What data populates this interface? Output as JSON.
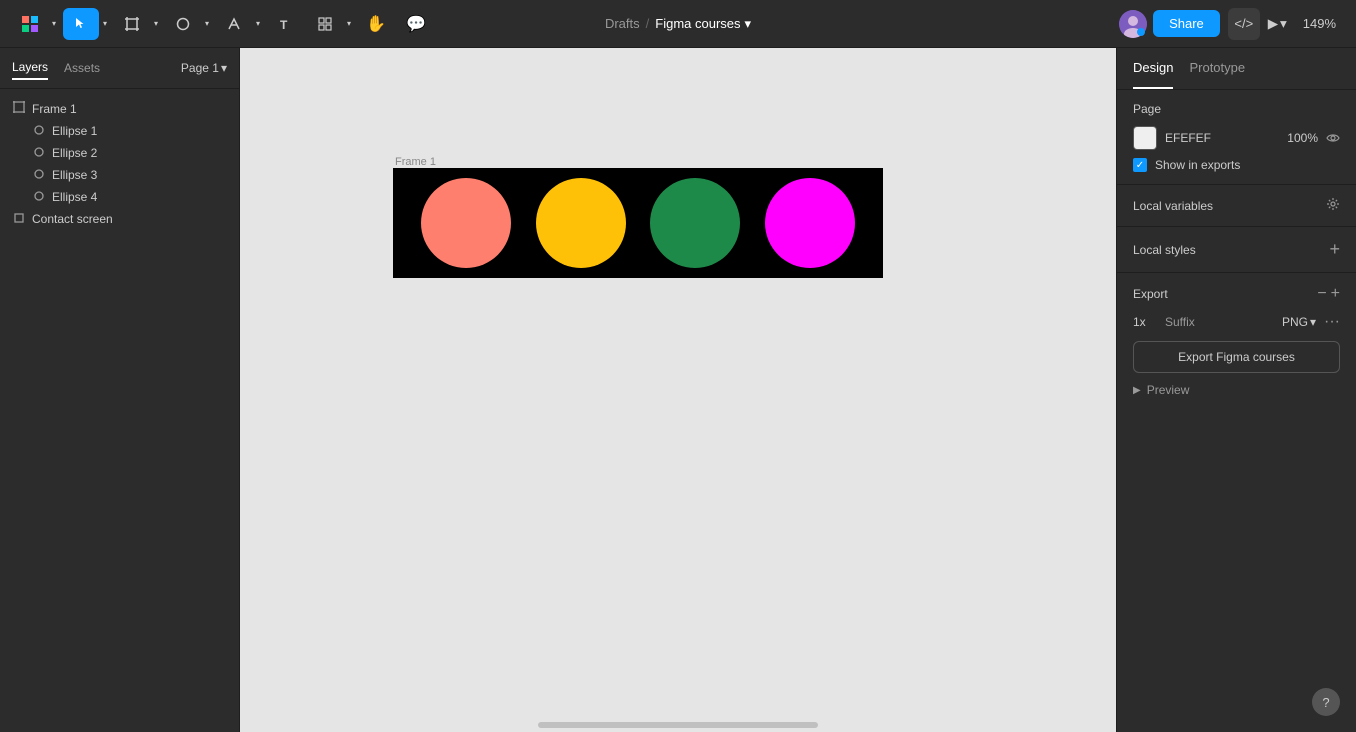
{
  "toolbar": {
    "breadcrumb_drafts": "Drafts",
    "breadcrumb_separator": "/",
    "breadcrumb_project": "Figma courses",
    "share_label": "Share",
    "zoom_level": "149%",
    "code_icon": "</>",
    "play_icon": "▶"
  },
  "left_panel": {
    "layers_tab": "Layers",
    "assets_tab": "Assets",
    "page_label": "Page 1",
    "layers": [
      {
        "id": "frame1",
        "label": "Frame 1",
        "type": "frame",
        "indent": 0
      },
      {
        "id": "ellipse1",
        "label": "Ellipse 1",
        "type": "ellipse",
        "indent": 1
      },
      {
        "id": "ellipse2",
        "label": "Ellipse 2",
        "type": "ellipse",
        "indent": 1
      },
      {
        "id": "ellipse3",
        "label": "Ellipse 3",
        "type": "ellipse",
        "indent": 1
      },
      {
        "id": "ellipse4",
        "label": "Ellipse 4",
        "type": "ellipse",
        "indent": 1
      },
      {
        "id": "contact",
        "label": "Contact screen",
        "type": "frame",
        "indent": 0
      }
    ]
  },
  "canvas": {
    "frame_label": "Frame 1",
    "background_color": "#e5e5e5",
    "frame_bg": "#000000",
    "circles": [
      {
        "color": "#FF7F6E",
        "size": 90
      },
      {
        "color": "#FFC107",
        "size": 90
      },
      {
        "color": "#1E8A4A",
        "size": 90
      },
      {
        "color": "#FF00FF",
        "size": 90
      }
    ]
  },
  "right_panel": {
    "design_tab": "Design",
    "prototype_tab": "Prototype",
    "page_section_title": "Page",
    "page_color_hex": "EFEFEF",
    "page_color_opacity": "100%",
    "show_exports_label": "Show in exports",
    "local_variables_title": "Local variables",
    "local_styles_title": "Local styles",
    "export_title": "Export",
    "export_scale": "1x",
    "export_suffix": "Suffix",
    "export_format": "PNG",
    "export_btn_label": "Export Figma courses",
    "preview_label": "Preview"
  }
}
